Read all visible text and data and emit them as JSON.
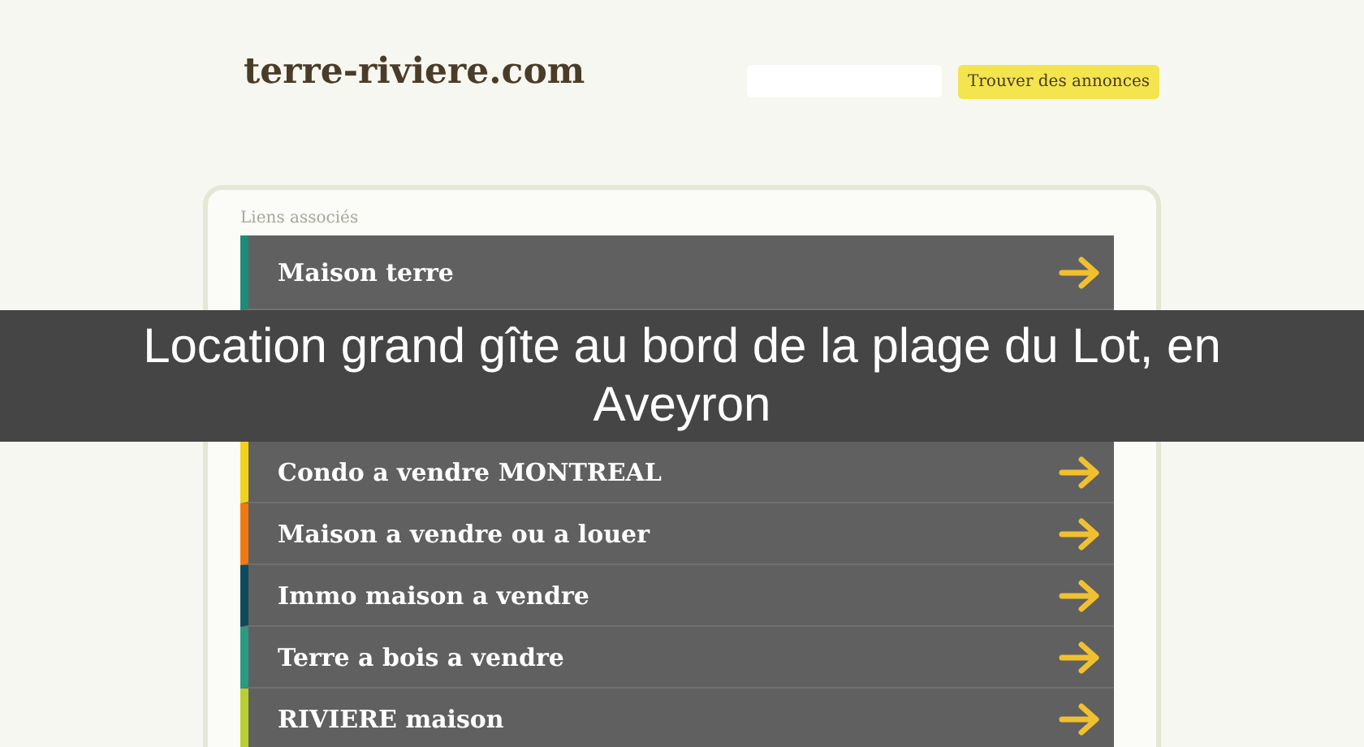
{
  "header": {
    "logo": "terre-riviere.com",
    "button": "Trouver des annonces"
  },
  "links": {
    "heading": "Liens associés",
    "items_above": [
      {
        "label": "Maison terre",
        "color": "#1f8a78"
      }
    ],
    "items_below": [
      {
        "label": "Condo a vendre MONTREAL",
        "color": "#f2d21a"
      },
      {
        "label": "Maison a vendre ou a louer",
        "color": "#f07a12"
      },
      {
        "label": "Immo maison a vendre",
        "color": "#0d4a5c"
      },
      {
        "label": "Terre a bois a vendre",
        "color": "#2a9a80"
      },
      {
        "label": "RIVIERE maison",
        "color": "#b8d030"
      }
    ]
  },
  "banner": {
    "title": "Location grand gîte au bord de la plage du Lot, en Aveyron"
  }
}
